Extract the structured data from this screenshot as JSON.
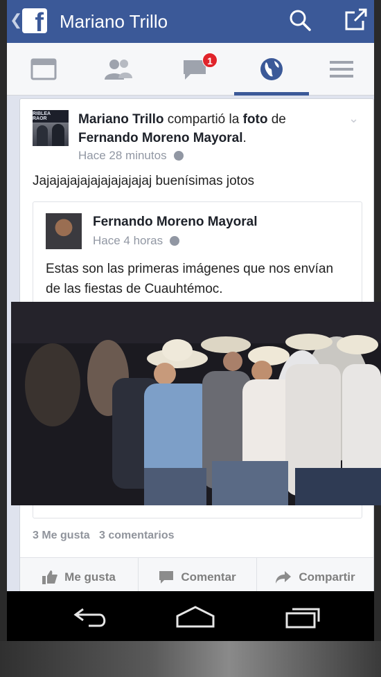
{
  "topbar": {
    "title": "Mariano Trillo",
    "color": "#3b5998"
  },
  "nav": {
    "items": [
      {
        "name": "news-feed-icon"
      },
      {
        "name": "friends-icon"
      },
      {
        "name": "messages-icon"
      },
      {
        "name": "globe-notifications-icon"
      },
      {
        "name": "menu-icon"
      }
    ],
    "badge_count": "1",
    "active": "globe-notifications-icon"
  },
  "post": {
    "author": "Mariano Trillo",
    "action_1": " compartió la ",
    "action_foto": "foto",
    "action_2": " de",
    "original_author": "Fernando Moreno Mayoral",
    "period": ".",
    "time": "Hace 28 minutos",
    "avatar_banner_text": "RIBLEA\nRAOR",
    "text": "Jajajajajajajajajajajaj buenísimas jotos",
    "shared": {
      "author": "Fernando Moreno Mayoral",
      "time": "Hace 4 horas",
      "text": "Estas son las primeras imágenes que nos envían de las fiestas de Cuauhtémoc."
    },
    "likes": "3 Me gusta",
    "comments": "3 comentarios"
  },
  "actions": {
    "like": "Me gusta",
    "comment": "Comentar",
    "share": "Compartir"
  }
}
